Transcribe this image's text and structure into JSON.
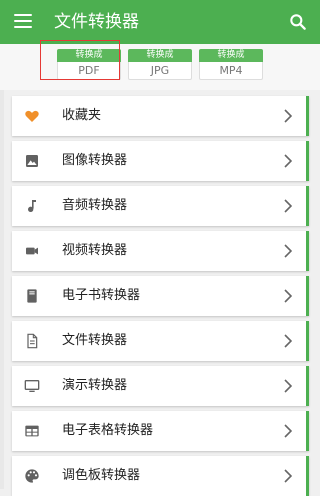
{
  "appbar": {
    "title": "文件转换器",
    "menu_icon": "menu-icon",
    "search_icon": "search-icon"
  },
  "chips": [
    {
      "top": "转换成",
      "bottom": "PDF"
    },
    {
      "top": "转换成",
      "bottom": "JPG"
    },
    {
      "top": "转换成",
      "bottom": "MP4"
    }
  ],
  "list": [
    {
      "label": "收藏夹",
      "icon": "heart-icon"
    },
    {
      "label": "图像转换器",
      "icon": "image-icon"
    },
    {
      "label": "音频转换器",
      "icon": "music-note-icon"
    },
    {
      "label": "视频转换器",
      "icon": "video-camera-icon"
    },
    {
      "label": "电子书转换器",
      "icon": "book-icon"
    },
    {
      "label": "文件转换器",
      "icon": "document-icon"
    },
    {
      "label": "演示转换器",
      "icon": "monitor-icon"
    },
    {
      "label": "电子表格转换器",
      "icon": "table-icon"
    },
    {
      "label": "调色板转换器",
      "icon": "palette-icon"
    }
  ],
  "colors": {
    "primary": "#4caf50",
    "chip_green": "#5cb85c",
    "favorite": "#f0902b",
    "highlight": "#e53935"
  }
}
